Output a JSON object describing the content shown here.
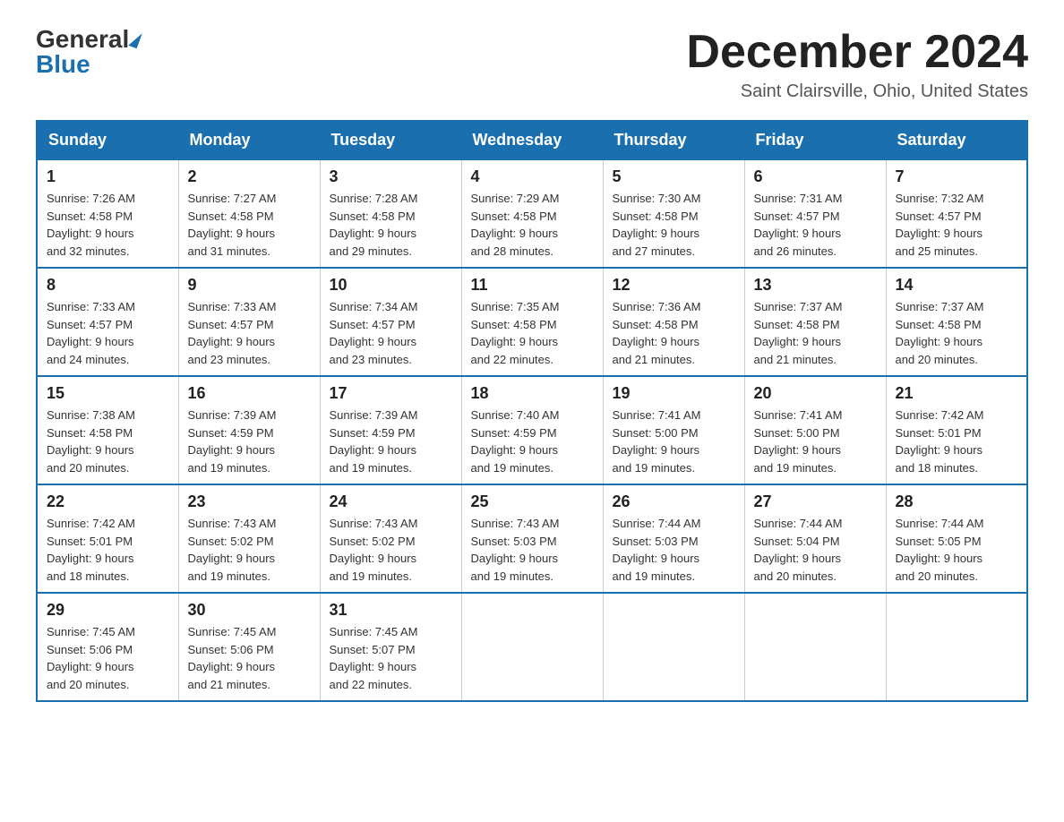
{
  "header": {
    "logo_general": "General",
    "logo_blue": "Blue",
    "month_title": "December 2024",
    "location": "Saint Clairsville, Ohio, United States"
  },
  "days_of_week": [
    "Sunday",
    "Monday",
    "Tuesday",
    "Wednesday",
    "Thursday",
    "Friday",
    "Saturday"
  ],
  "weeks": [
    [
      {
        "day": "1",
        "sunrise": "7:26 AM",
        "sunset": "4:58 PM",
        "daylight": "9 hours and 32 minutes."
      },
      {
        "day": "2",
        "sunrise": "7:27 AM",
        "sunset": "4:58 PM",
        "daylight": "9 hours and 31 minutes."
      },
      {
        "day": "3",
        "sunrise": "7:28 AM",
        "sunset": "4:58 PM",
        "daylight": "9 hours and 29 minutes."
      },
      {
        "day": "4",
        "sunrise": "7:29 AM",
        "sunset": "4:58 PM",
        "daylight": "9 hours and 28 minutes."
      },
      {
        "day": "5",
        "sunrise": "7:30 AM",
        "sunset": "4:58 PM",
        "daylight": "9 hours and 27 minutes."
      },
      {
        "day": "6",
        "sunrise": "7:31 AM",
        "sunset": "4:57 PM",
        "daylight": "9 hours and 26 minutes."
      },
      {
        "day": "7",
        "sunrise": "7:32 AM",
        "sunset": "4:57 PM",
        "daylight": "9 hours and 25 minutes."
      }
    ],
    [
      {
        "day": "8",
        "sunrise": "7:33 AM",
        "sunset": "4:57 PM",
        "daylight": "9 hours and 24 minutes."
      },
      {
        "day": "9",
        "sunrise": "7:33 AM",
        "sunset": "4:57 PM",
        "daylight": "9 hours and 23 minutes."
      },
      {
        "day": "10",
        "sunrise": "7:34 AM",
        "sunset": "4:57 PM",
        "daylight": "9 hours and 23 minutes."
      },
      {
        "day": "11",
        "sunrise": "7:35 AM",
        "sunset": "4:58 PM",
        "daylight": "9 hours and 22 minutes."
      },
      {
        "day": "12",
        "sunrise": "7:36 AM",
        "sunset": "4:58 PM",
        "daylight": "9 hours and 21 minutes."
      },
      {
        "day": "13",
        "sunrise": "7:37 AM",
        "sunset": "4:58 PM",
        "daylight": "9 hours and 21 minutes."
      },
      {
        "day": "14",
        "sunrise": "7:37 AM",
        "sunset": "4:58 PM",
        "daylight": "9 hours and 20 minutes."
      }
    ],
    [
      {
        "day": "15",
        "sunrise": "7:38 AM",
        "sunset": "4:58 PM",
        "daylight": "9 hours and 20 minutes."
      },
      {
        "day": "16",
        "sunrise": "7:39 AM",
        "sunset": "4:59 PM",
        "daylight": "9 hours and 19 minutes."
      },
      {
        "day": "17",
        "sunrise": "7:39 AM",
        "sunset": "4:59 PM",
        "daylight": "9 hours and 19 minutes."
      },
      {
        "day": "18",
        "sunrise": "7:40 AM",
        "sunset": "4:59 PM",
        "daylight": "9 hours and 19 minutes."
      },
      {
        "day": "19",
        "sunrise": "7:41 AM",
        "sunset": "5:00 PM",
        "daylight": "9 hours and 19 minutes."
      },
      {
        "day": "20",
        "sunrise": "7:41 AM",
        "sunset": "5:00 PM",
        "daylight": "9 hours and 19 minutes."
      },
      {
        "day": "21",
        "sunrise": "7:42 AM",
        "sunset": "5:01 PM",
        "daylight": "9 hours and 18 minutes."
      }
    ],
    [
      {
        "day": "22",
        "sunrise": "7:42 AM",
        "sunset": "5:01 PM",
        "daylight": "9 hours and 18 minutes."
      },
      {
        "day": "23",
        "sunrise": "7:43 AM",
        "sunset": "5:02 PM",
        "daylight": "9 hours and 19 minutes."
      },
      {
        "day": "24",
        "sunrise": "7:43 AM",
        "sunset": "5:02 PM",
        "daylight": "9 hours and 19 minutes."
      },
      {
        "day": "25",
        "sunrise": "7:43 AM",
        "sunset": "5:03 PM",
        "daylight": "9 hours and 19 minutes."
      },
      {
        "day": "26",
        "sunrise": "7:44 AM",
        "sunset": "5:03 PM",
        "daylight": "9 hours and 19 minutes."
      },
      {
        "day": "27",
        "sunrise": "7:44 AM",
        "sunset": "5:04 PM",
        "daylight": "9 hours and 20 minutes."
      },
      {
        "day": "28",
        "sunrise": "7:44 AM",
        "sunset": "5:05 PM",
        "daylight": "9 hours and 20 minutes."
      }
    ],
    [
      {
        "day": "29",
        "sunrise": "7:45 AM",
        "sunset": "5:06 PM",
        "daylight": "9 hours and 20 minutes."
      },
      {
        "day": "30",
        "sunrise": "7:45 AM",
        "sunset": "5:06 PM",
        "daylight": "9 hours and 21 minutes."
      },
      {
        "day": "31",
        "sunrise": "7:45 AM",
        "sunset": "5:07 PM",
        "daylight": "9 hours and 22 minutes."
      },
      null,
      null,
      null,
      null
    ]
  ]
}
